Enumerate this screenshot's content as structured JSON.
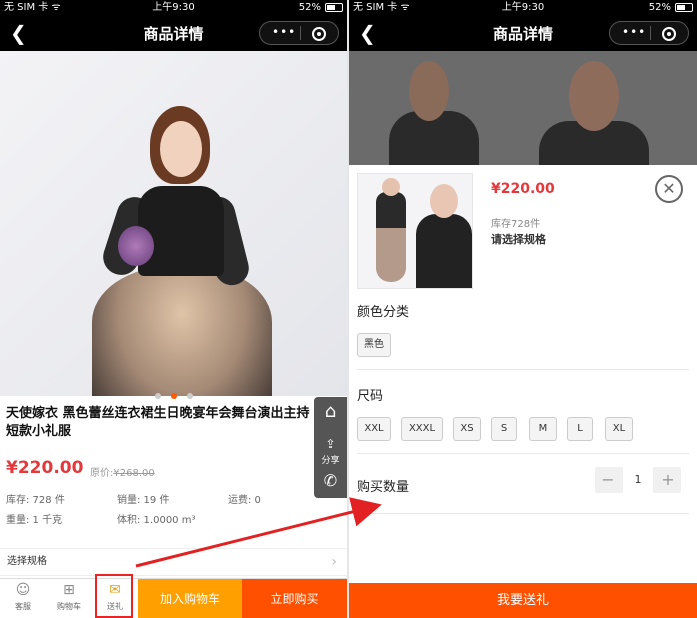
{
  "status": {
    "carrier": "无 SIM 卡 ᯤ",
    "time": "上午9:30",
    "battery": "52%"
  },
  "nav": {
    "back": "❮",
    "title": "商品详情",
    "more": "•••"
  },
  "left": {
    "product_title": "天使嫁衣 黑色蕾丝连衣裙生日晚宴年会舞台演出主持短款小礼服",
    "price": "¥220.00",
    "orig_label": "原价:",
    "orig_price": "¥268.00",
    "stock": "库存: 728 件",
    "sales": "销量: 19 件",
    "shipping": "运费: 0",
    "weight": "重量: 1 千克",
    "volume": "体积: 1.0000 m³",
    "spec_row": "选择规格",
    "float": {
      "share": "分享"
    },
    "bottom": {
      "service": "客服",
      "cart": "购物车",
      "gift": "送礼",
      "add_cart": "加入购物车",
      "buy_now": "立即购买"
    }
  },
  "right": {
    "price": "¥220.00",
    "stock": "库存728件",
    "choose": "请选择规格",
    "close": "✕",
    "color_title": "颜色分类",
    "color_options": [
      "黑色"
    ],
    "size_title": "尺码",
    "size_options": [
      "XXL",
      "XXXL",
      "XS",
      "S",
      "M",
      "L",
      "XL"
    ],
    "qty_title": "购买数量",
    "qty": "1",
    "minus": "−",
    "plus": "+",
    "gift_button": "我要送礼"
  },
  "colors": {
    "accent": "#ff5000",
    "price": "#e4393c",
    "cart": "#ff9f00",
    "annotation": "#e22222"
  }
}
